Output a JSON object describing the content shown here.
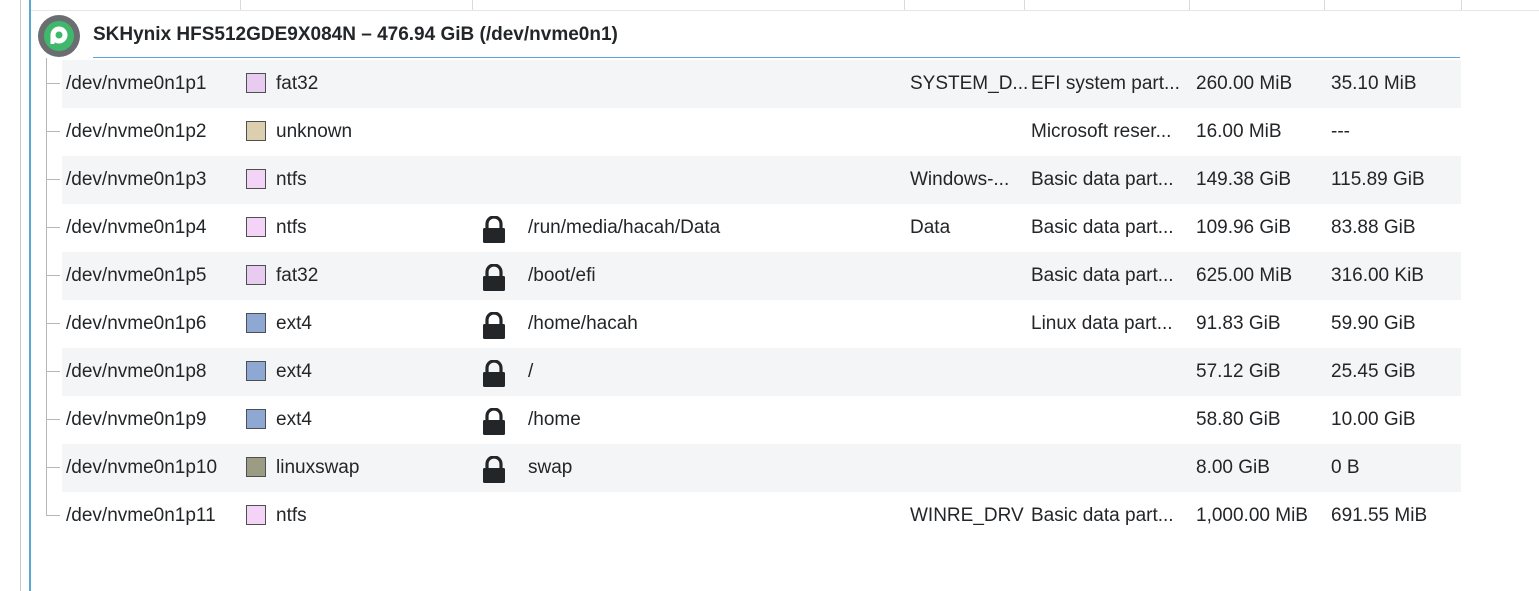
{
  "device": {
    "title": "SKHynix HFS512GDE9X084N – 476.94 GiB (/dev/nvme0n1)",
    "icon": "disk-icon"
  },
  "colors": {
    "selection_accent": "#5aa7d6",
    "fat32": "#e8ccf0",
    "ntfs": "#f3d4f7",
    "unknown": "#dccfb0",
    "ext4": "#8fa7d3",
    "linuxswap": "#9c9c84"
  },
  "partitions": [
    {
      "name": "/dev/nvme0n1p1",
      "fs": "fat32",
      "fs_color": "#e8ccf0",
      "locked": false,
      "mount": "",
      "label": "SYSTEM_D...",
      "type": "EFI system part...",
      "size": "260.00 MiB",
      "used": "35.10 MiB"
    },
    {
      "name": "/dev/nvme0n1p2",
      "fs": "unknown",
      "fs_color": "#dccfb0",
      "locked": false,
      "mount": "",
      "label": "",
      "type": "Microsoft reser...",
      "size": "16.00 MiB",
      "used": "---"
    },
    {
      "name": "/dev/nvme0n1p3",
      "fs": "ntfs",
      "fs_color": "#f3d4f7",
      "locked": false,
      "mount": "",
      "label": "Windows-...",
      "type": "Basic data part...",
      "size": "149.38 GiB",
      "used": "115.89 GiB"
    },
    {
      "name": "/dev/nvme0n1p4",
      "fs": "ntfs",
      "fs_color": "#f3d4f7",
      "locked": true,
      "mount": "/run/media/hacah/Data",
      "label": "Data",
      "type": "Basic data part...",
      "size": "109.96 GiB",
      "used": "83.88 GiB"
    },
    {
      "name": "/dev/nvme0n1p5",
      "fs": "fat32",
      "fs_color": "#e8ccf0",
      "locked": true,
      "mount": "/boot/efi",
      "label": "",
      "type": "Basic data part...",
      "size": "625.00 MiB",
      "used": "316.00 KiB"
    },
    {
      "name": "/dev/nvme0n1p6",
      "fs": "ext4",
      "fs_color": "#8fa7d3",
      "locked": true,
      "mount": "/home/hacah",
      "label": "",
      "type": "Linux data part...",
      "size": "91.83 GiB",
      "used": "59.90 GiB"
    },
    {
      "name": "/dev/nvme0n1p8",
      "fs": "ext4",
      "fs_color": "#8fa7d3",
      "locked": true,
      "mount": "/",
      "label": "",
      "type": "",
      "size": "57.12 GiB",
      "used": "25.45 GiB"
    },
    {
      "name": "/dev/nvme0n1p9",
      "fs": "ext4",
      "fs_color": "#8fa7d3",
      "locked": true,
      "mount": "/home",
      "label": "",
      "type": "",
      "size": "58.80 GiB",
      "used": "10.00 GiB"
    },
    {
      "name": "/dev/nvme0n1p10",
      "fs": "linuxswap",
      "fs_color": "#9c9c84",
      "locked": true,
      "mount": "swap",
      "label": "",
      "type": "",
      "size": "8.00 GiB",
      "used": "0 B"
    },
    {
      "name": "/dev/nvme0n1p11",
      "fs": "ntfs",
      "fs_color": "#f3d4f7",
      "locked": false,
      "mount": "",
      "label": "WINRE_DRV",
      "type": "Basic data part...",
      "size": "1,000.00 MiB",
      "used": "691.55 MiB"
    }
  ]
}
